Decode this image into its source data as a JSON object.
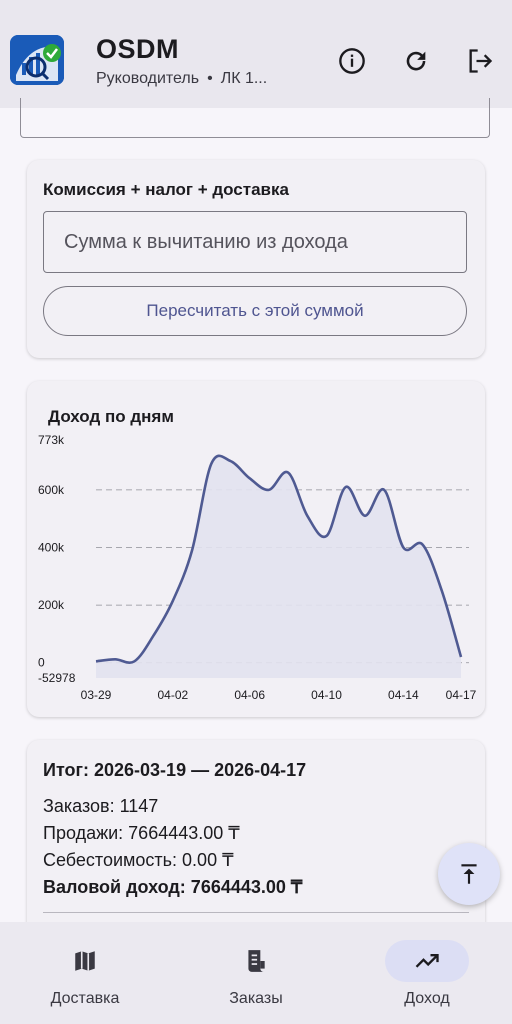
{
  "header": {
    "title": "OSDM",
    "subtitle_role": "Руководитель",
    "subtitle_separator": "•",
    "subtitle_account": "ЛК 1...",
    "logo_icon": "analytics-check-logo",
    "actions": [
      {
        "name": "info-icon"
      },
      {
        "name": "refresh-icon"
      },
      {
        "name": "logout-icon"
      }
    ]
  },
  "deduction": {
    "label": "Комиссия + налог + доставка",
    "input_placeholder": "Сумма к вычитанию из дохода",
    "input_value": "",
    "button_label": "Пересчитать с этой суммой"
  },
  "chart": {
    "title": "Доход по дням"
  },
  "chart_data": {
    "type": "area",
    "title": "Доход по дням",
    "xlabel": "",
    "ylabel": "",
    "x_tick_labels": [
      "03-29",
      "04-02",
      "04-06",
      "04-10",
      "04-14",
      "04-17"
    ],
    "y_tick_labels": [
      "773k",
      "600k",
      "400k",
      "200k",
      "0",
      "-52978"
    ],
    "ylim": [
      -52978,
      773000
    ],
    "grid": true,
    "series": [
      {
        "values": [
          {
            "x": "03-29",
            "y": 5000
          },
          {
            "x": "03-30",
            "y": 12000
          },
          {
            "x": "03-31",
            "y": 5000
          },
          {
            "x": "04-01",
            "y": 95000
          },
          {
            "x": "04-02",
            "y": 215000
          },
          {
            "x": "04-03",
            "y": 390000
          },
          {
            "x": "04-04",
            "y": 690000
          },
          {
            "x": "04-05",
            "y": 700000
          },
          {
            "x": "04-06",
            "y": 640000
          },
          {
            "x": "04-07",
            "y": 600000
          },
          {
            "x": "04-08",
            "y": 660000
          },
          {
            "x": "04-09",
            "y": 510000
          },
          {
            "x": "04-10",
            "y": 440000
          },
          {
            "x": "04-11",
            "y": 610000
          },
          {
            "x": "04-12",
            "y": 510000
          },
          {
            "x": "04-13",
            "y": 600000
          },
          {
            "x": "04-14",
            "y": 400000
          },
          {
            "x": "04-15",
            "y": 410000
          },
          {
            "x": "04-16",
            "y": 250000
          },
          {
            "x": "04-17",
            "y": 20000
          }
        ]
      }
    ],
    "colors": {
      "line": "#4f5a92",
      "fill": "#e2e2ef",
      "grid": "#8e8e96"
    }
  },
  "summary": {
    "title": "Итог: 2026-03-19 — 2026-04-17",
    "orders": "Заказов: 1147",
    "sales": "Продажи: 7664443.00 ₸",
    "cost": "Себестоимость: 0.00 ₸",
    "gross": "Валовой доход: 7664443.00 ₸"
  },
  "fab": {
    "icon": "scroll-to-top-icon"
  },
  "nav": {
    "items": [
      {
        "label": "Доставка",
        "icon": "map-icon",
        "active": false
      },
      {
        "label": "Заказы",
        "icon": "receipt-icon",
        "active": false
      },
      {
        "label": "Доход",
        "icon": "trending-up-icon",
        "active": true
      }
    ]
  },
  "colors": {
    "accent": "#4f5590",
    "app_bar": "#e9e7ee",
    "nav_active_pill": "#dcdef4",
    "fab": "#dfe2f8"
  }
}
